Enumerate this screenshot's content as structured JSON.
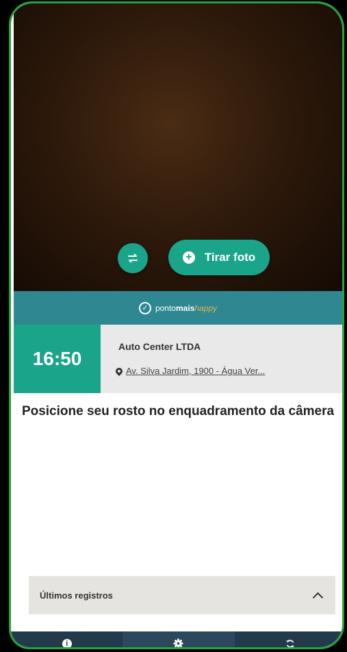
{
  "camera": {
    "switch_icon": "switch-camera-icon",
    "photo_label": "Tirar foto",
    "photo_icon": "plus-circle-icon"
  },
  "brand": {
    "name_regular": "ponto",
    "name_bold": "mais",
    "name_accent": "happy"
  },
  "clock": {
    "time": "16:50"
  },
  "location": {
    "company": "Auto Center LTDA",
    "address": "Av. Silva Jardim, 1900 - Água Ver..."
  },
  "instruction": "Posicione seu rosto no enquadramento da câmera",
  "records": {
    "label": "Últimos registros"
  },
  "nav": {
    "items": [
      {
        "icon": "info-icon"
      },
      {
        "icon": "gear-icon"
      },
      {
        "icon": "sync-icon"
      }
    ]
  },
  "colors": {
    "accent": "#1aa58a",
    "brand_bar": "#2e8791",
    "nav_bg": "#233a4d",
    "frame_border": "#22a63a"
  }
}
